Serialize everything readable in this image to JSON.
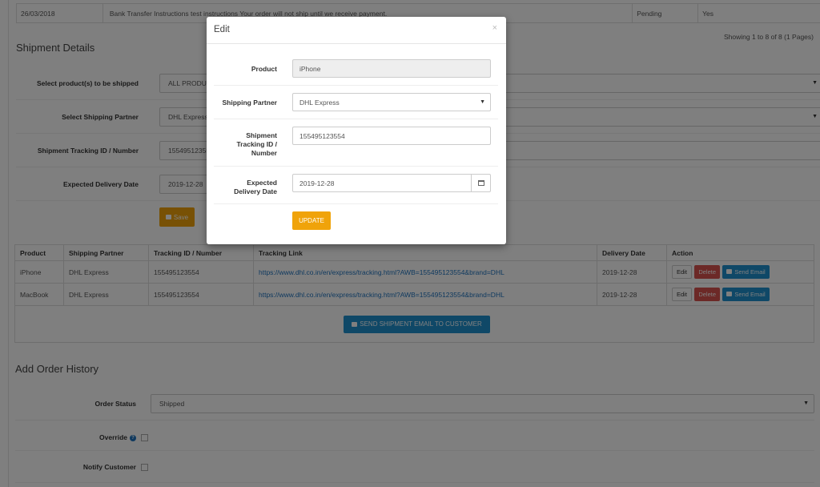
{
  "history": {
    "date": "26/03/2018",
    "comment": "Bank Transfer Instructions test instructions Your order will not ship until we receive payment.",
    "status": "Pending",
    "notify": "Yes",
    "showing": "Showing 1 to 8 of 8 (1 Pages)"
  },
  "shipment": {
    "title": "Shipment Details",
    "products_label": "Select product(s) to be shipped",
    "products_value": "ALL PRODUCTS",
    "partner_label": "Select Shipping Partner",
    "partner_value": "DHL Express",
    "tracking_label": "Shipment Tracking ID / Number",
    "tracking_value": "155495123554",
    "date_label": "Expected Delivery Date",
    "date_value": "2019-12-28",
    "save_label": "Save"
  },
  "table": {
    "headers": [
      "Product",
      "Shipping Partner",
      "Tracking ID / Number",
      "Tracking Link",
      "Delivery Date",
      "Action"
    ],
    "rows": [
      {
        "product": "iPhone",
        "partner": "DHL Express",
        "tracking": "155495123554",
        "link": "https://www.dhl.co.in/en/express/tracking.html?AWB=155495123554&brand=DHL",
        "date": "2019-12-28"
      },
      {
        "product": "MacBook",
        "partner": "DHL Express",
        "tracking": "155495123554",
        "link": "https://www.dhl.co.in/en/express/tracking.html?AWB=155495123554&brand=DHL",
        "date": "2019-12-28"
      }
    ],
    "edit_label": "Edit",
    "delete_label": "Delete",
    "send_label": "Send Email",
    "ship_email_label": "SEND SHIPMENT EMAIL TO CUSTOMER"
  },
  "order_history": {
    "title": "Add Order History",
    "status_label": "Order Status",
    "status_value": "Shipped",
    "override_label": "Override",
    "notify_label": "Notify Customer"
  },
  "modal": {
    "title": "Edit",
    "close": "×",
    "product_label": "Product",
    "product_value": "iPhone",
    "partner_label": "Shipping Partner",
    "partner_value": "DHL Express",
    "tracking_label_1": "Shipment",
    "tracking_label_2": "Tracking ID /",
    "tracking_label_3": "Number",
    "tracking_value": "155495123554",
    "date_label_1": "Expected",
    "date_label_2": "Delivery Date",
    "date_value": "2019-12-28",
    "update_label": "UPDATE"
  },
  "colors": {
    "accent_orange": "#f0a30a",
    "link_blue": "#1e73be",
    "delete_red": "#d9534f",
    "email_blue": "#1e91cf"
  }
}
